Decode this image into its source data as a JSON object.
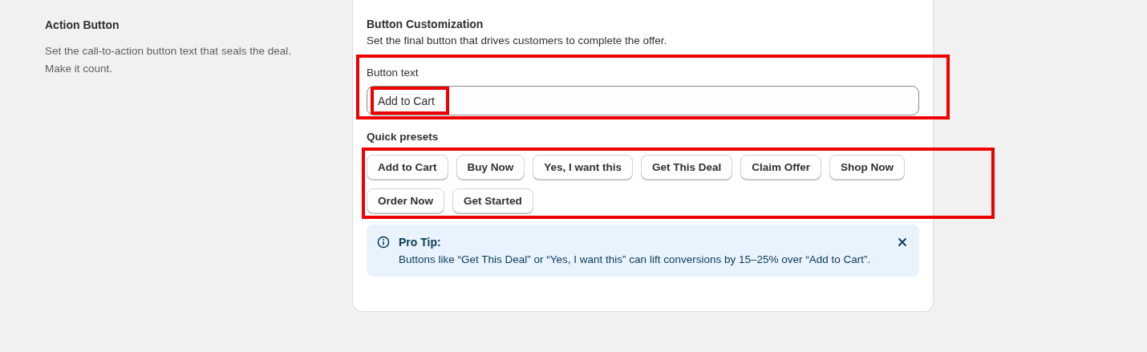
{
  "section": {
    "title": "Action Button",
    "description": "Set the call-to-action button text that seals the deal. Make it count."
  },
  "card": {
    "title": "Button Customization",
    "subtitle": "Set the final button that drives customers to complete the offer.",
    "field": {
      "label": "Button text",
      "value": "Add to Cart"
    },
    "presets_label": "Quick presets",
    "presets": [
      "Add to Cart",
      "Buy Now",
      "Yes, I want this",
      "Get This Deal",
      "Claim Offer",
      "Shop Now",
      "Order Now",
      "Get Started"
    ],
    "tip": {
      "title": "Pro Tip:",
      "text": "Buttons like “Get This Deal” or “Yes, I want this” can lift conversions by 15–25% over “Add to Cart”."
    }
  }
}
